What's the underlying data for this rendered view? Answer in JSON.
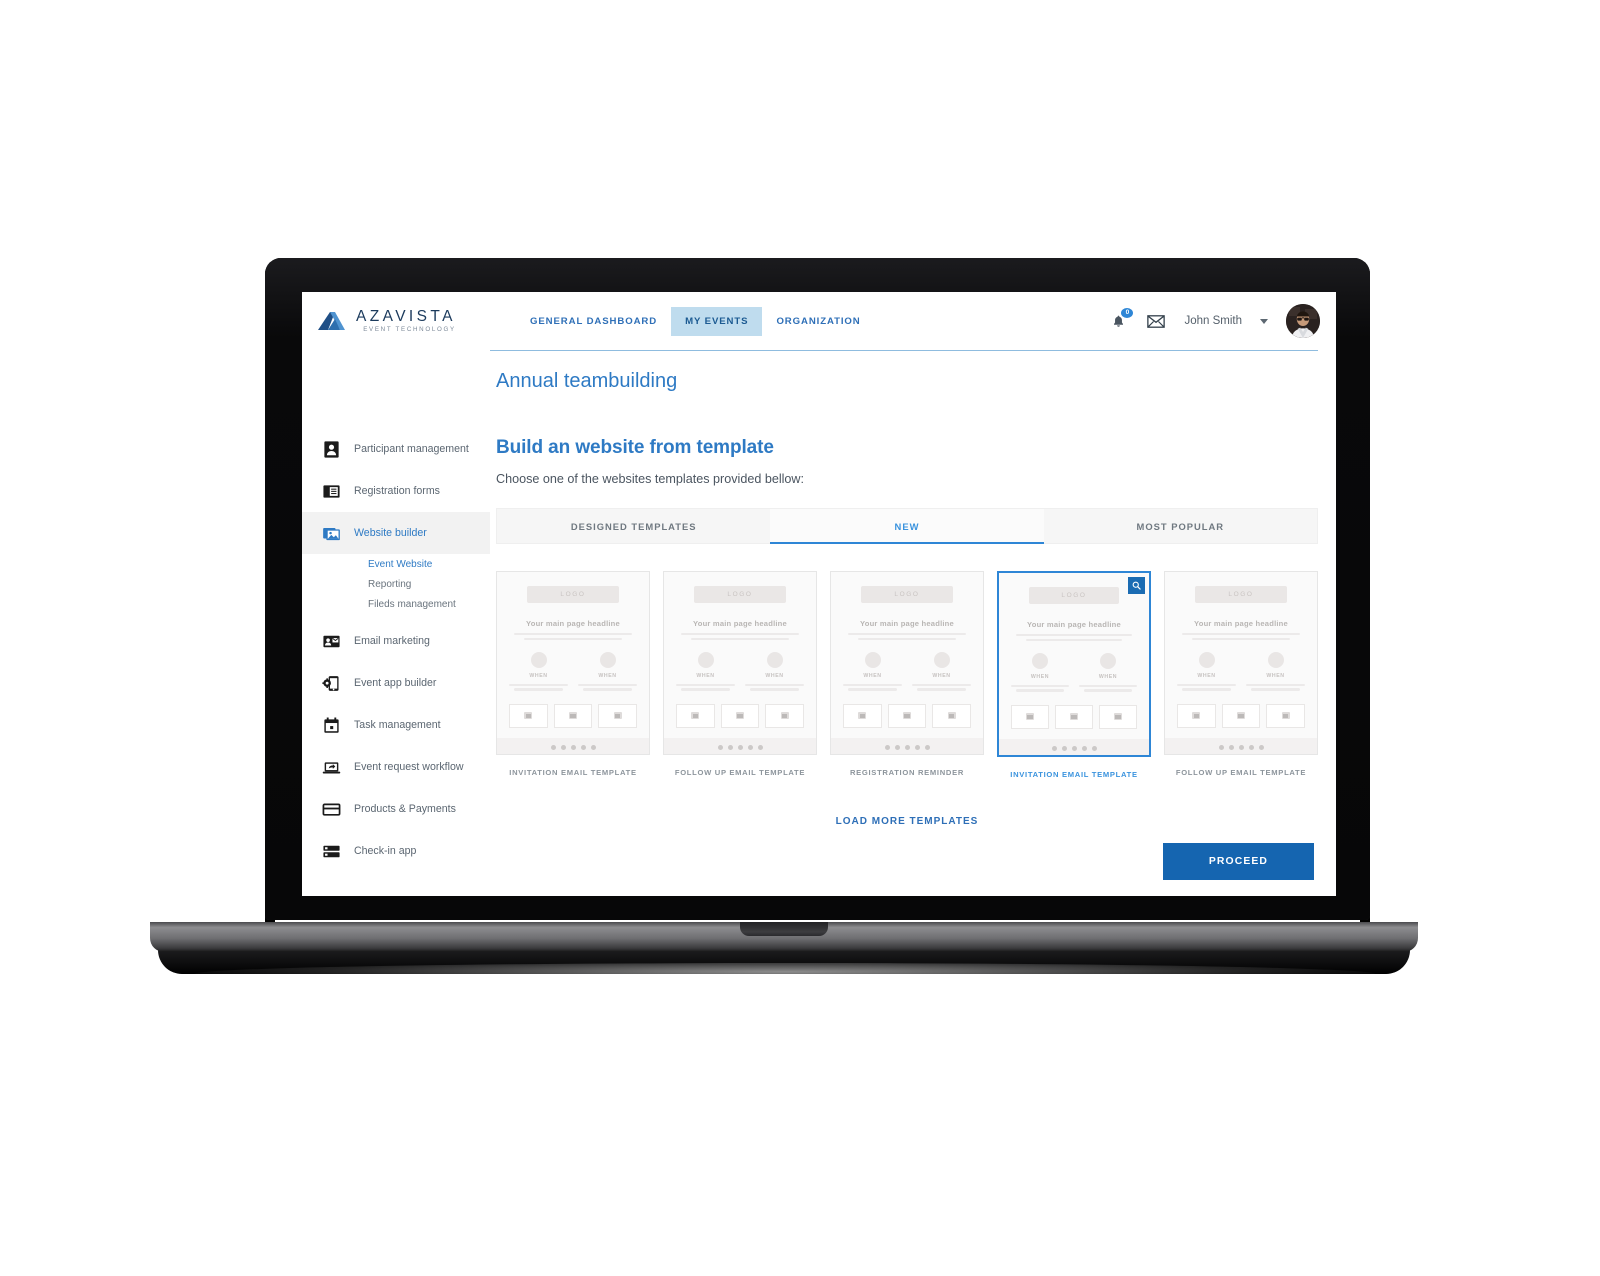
{
  "brand": {
    "name": "AZAVISTA",
    "tagline": "EVENT TECHNOLOGY",
    "logo_icon": "azavista-arrow-logo"
  },
  "topnav": {
    "items": [
      {
        "label": "GENERAL DASHBOARD",
        "active": false
      },
      {
        "label": "MY EVENTS",
        "active": true
      },
      {
        "label": "ORGANIZATION",
        "active": false
      }
    ],
    "notifications_icon": "bell-icon",
    "notifications_count": "0",
    "messages_icon": "envelope-icon",
    "username": "John Smith",
    "caret_icon": "chevron-down-icon",
    "avatar": "user-avatar"
  },
  "event": {
    "title": "Annual teambuilding"
  },
  "sidebar": {
    "items": [
      {
        "label": "Participant management",
        "icon": "contact-card-icon",
        "active": false
      },
      {
        "label": "Registration forms",
        "icon": "form-list-icon",
        "active": false
      },
      {
        "label": "Website builder",
        "icon": "image-stack-icon",
        "active": true,
        "submenu": [
          {
            "label": "Event Website",
            "active": true
          },
          {
            "label": "Reporting",
            "active": false
          },
          {
            "label": "Fileds management",
            "active": false
          }
        ]
      },
      {
        "label": "Email marketing",
        "icon": "email-contact-icon",
        "active": false
      },
      {
        "label": "Event app builder",
        "icon": "phone-gear-icon",
        "active": false
      },
      {
        "label": "Task management",
        "icon": "calendar-icon",
        "active": false
      },
      {
        "label": "Event request workflow",
        "icon": "laptop-share-icon",
        "active": false
      },
      {
        "label": "Products & Payments",
        "icon": "credit-card-icon",
        "active": false
      },
      {
        "label": "Check-in app",
        "icon": "checkin-device-icon",
        "active": false
      }
    ]
  },
  "main": {
    "heading": "Build an website from template",
    "subheading": "Choose one of the websites templates provided bellow:",
    "tabs": [
      {
        "label": "DESIGNED TEMPLATES",
        "active": false
      },
      {
        "label": "NEW",
        "active": true
      },
      {
        "label": "MOST POPULAR",
        "active": false
      }
    ],
    "template_preview": {
      "logo_label": "LOGO",
      "headline": "Your main page headline",
      "when_label": "WHEN",
      "search_icon": "magnifier-icon"
    },
    "templates": [
      {
        "label": "INVITATION EMAIL TEMPLATE",
        "selected": false
      },
      {
        "label": "FOLLOW UP EMAIL TEMPLATE",
        "selected": false
      },
      {
        "label": "REGISTRATION REMINDER",
        "selected": false
      },
      {
        "label": "INVITATION EMAIL TEMPLATE",
        "selected": true
      },
      {
        "label": "FOLLOW UP EMAIL TEMPLATE",
        "selected": false
      }
    ],
    "load_more_label": "LOAD MORE TEMPLATES",
    "proceed_label": "PROCEED"
  },
  "colors": {
    "accent_blue": "#2e7ac4",
    "tab_active": "#3a93de",
    "proceed_bg": "#1565b0",
    "nav_active_bg": "#bfdcee"
  }
}
